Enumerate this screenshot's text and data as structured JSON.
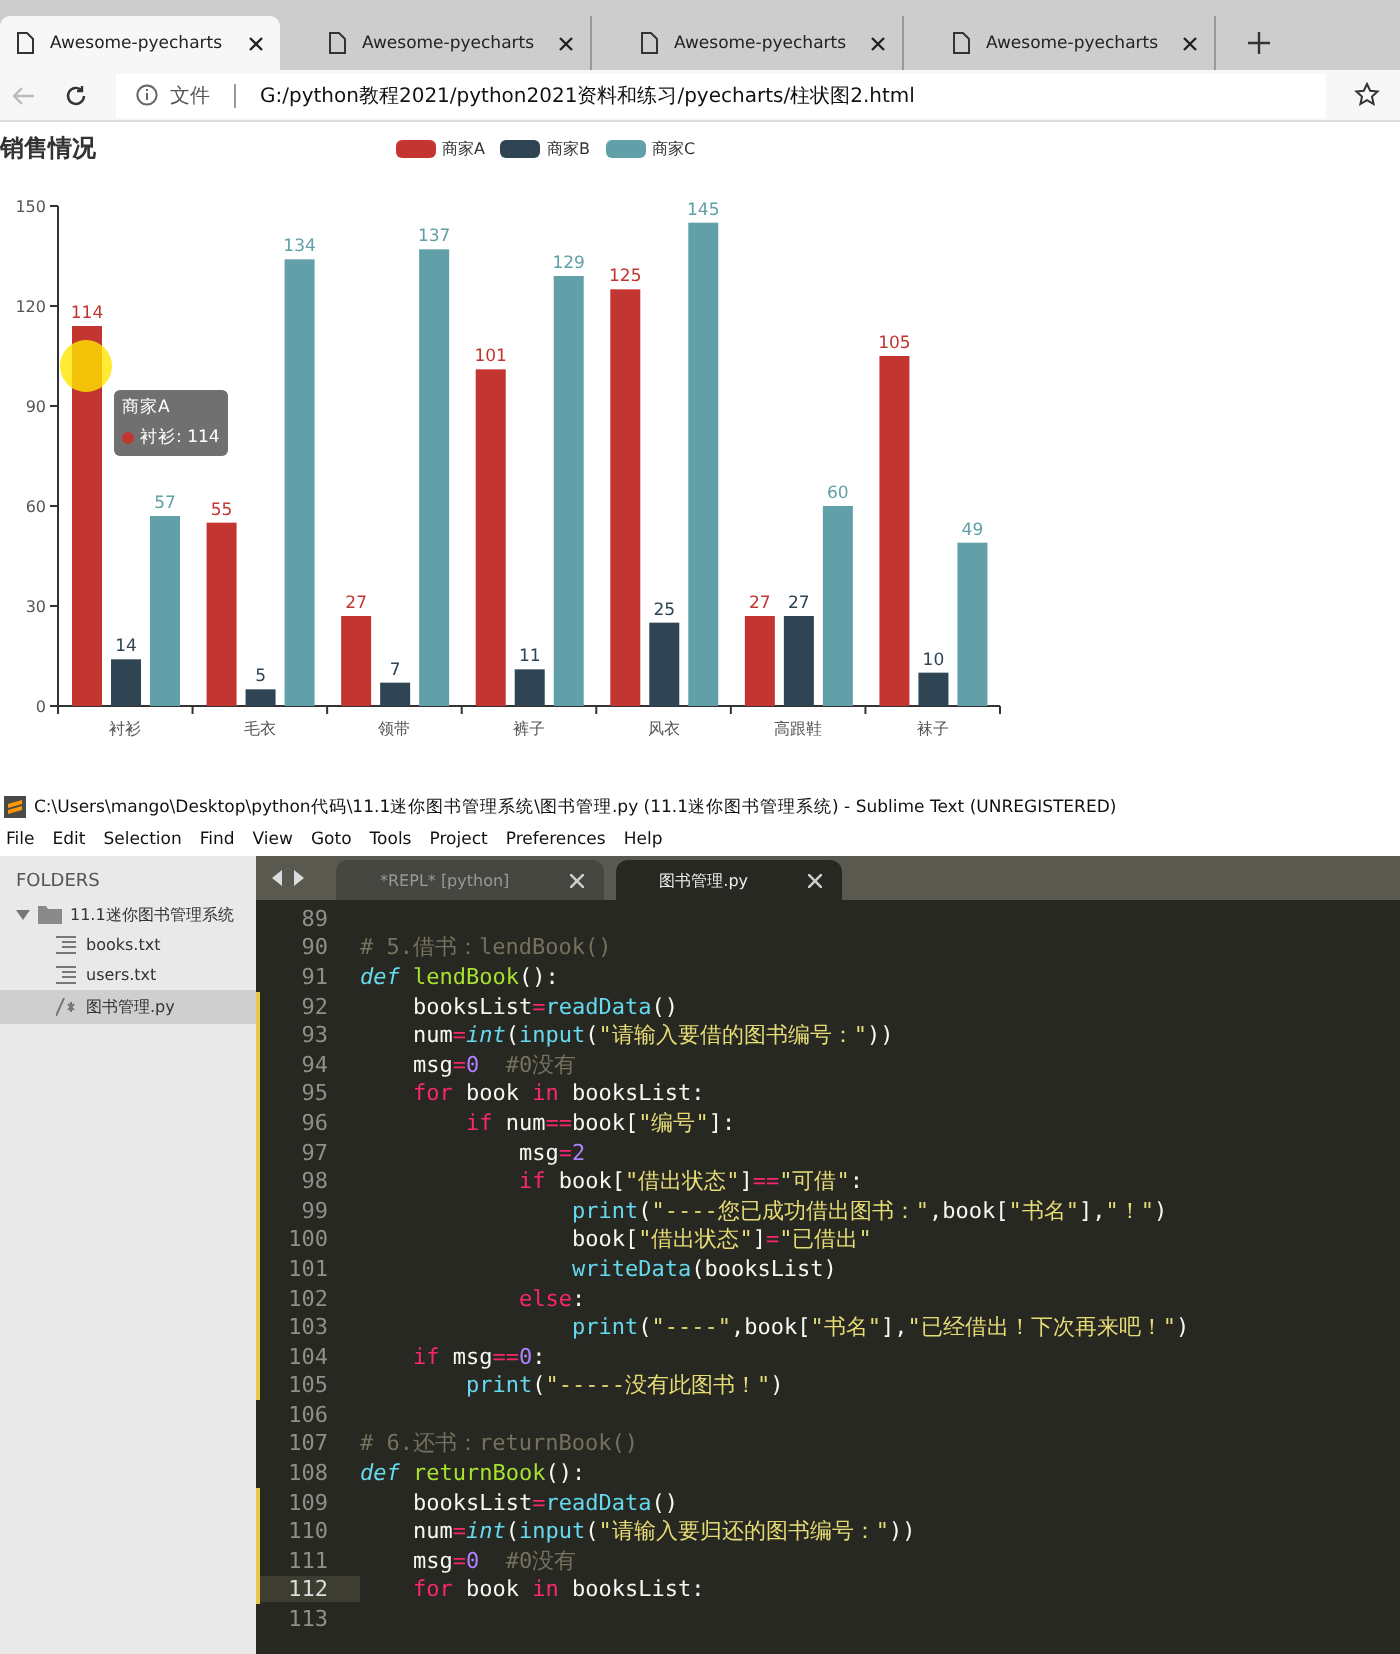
{
  "browser": {
    "tabs": [
      {
        "label": "Awesome-pyecharts",
        "selected": true
      },
      {
        "label": "Awesome-pyecharts",
        "selected": false
      },
      {
        "label": "Awesome-pyecharts",
        "selected": false
      },
      {
        "label": "Awesome-pyecharts",
        "selected": false
      }
    ],
    "address_bar": {
      "scheme_label": "文件",
      "url": "G:/python教程2021/python2021资料和练习/pyecharts/柱状图2.html"
    }
  },
  "chart_panel": {
    "title": "销售情况",
    "chart_data": {
      "type": "bar",
      "categories": [
        "衬衫",
        "毛衣",
        "领带",
        "裤子",
        "风衣",
        "高跟鞋",
        "袜子"
      ],
      "series": [
        {
          "name": "商家A",
          "color": "#c23531",
          "values": [
            114,
            55,
            27,
            101,
            125,
            27,
            105
          ]
        },
        {
          "name": "商家B",
          "color": "#2f4554",
          "values": [
            14,
            5,
            7,
            11,
            25,
            27,
            10
          ]
        },
        {
          "name": "商家C",
          "color": "#61a0a8",
          "values": [
            57,
            134,
            137,
            129,
            145,
            60,
            49
          ]
        }
      ],
      "ylim": [
        0,
        150
      ],
      "yticks": [
        0,
        30,
        60,
        90,
        120,
        150
      ],
      "data_labels": true
    },
    "tooltip": {
      "title": "商家A",
      "text": "衬衫: 114"
    }
  },
  "editor": {
    "title": "C:\\Users\\mango\\Desktop\\python代码\\11.1迷你图书管理系统\\图书管理.py (11.1迷你图书管理系统) - Sublime Text (UNREGISTERED)",
    "menu": [
      "File",
      "Edit",
      "Selection",
      "Find",
      "View",
      "Goto",
      "Tools",
      "Project",
      "Preferences",
      "Help"
    ],
    "sidebar": {
      "header": "FOLDERS",
      "folders": [
        {
          "name": "11.1迷你图书管理系统",
          "expanded": true,
          "children": [
            {
              "name": "books.txt",
              "kind": "text",
              "selected": false
            },
            {
              "name": "users.txt",
              "kind": "text",
              "selected": false
            },
            {
              "name": "图书管理.py",
              "kind": "code",
              "selected": true
            }
          ]
        }
      ]
    },
    "tabs": [
      {
        "label": "*REPL* [python]",
        "selected": false
      },
      {
        "label": "图书管理.py",
        "selected": true
      }
    ],
    "lines": [
      {
        "number": "89",
        "modified": false,
        "current": false
      },
      {
        "number": "90",
        "modified": false,
        "current": false,
        "tokens": [
          {
            "kind": "comment",
            "text": "# 5.借书：lendBook()"
          }
        ]
      },
      {
        "number": "91",
        "modified": false,
        "current": false,
        "tokens": [
          {
            "kind": "storage",
            "text": "def "
          },
          {
            "kind": "entity",
            "text": "lendBook"
          },
          {
            "kind": "plain",
            "text": "():"
          }
        ]
      },
      {
        "number": "92",
        "modified": true,
        "current": false,
        "tokens": [
          {
            "kind": "plain",
            "text": "    booksList"
          },
          {
            "kind": "operator",
            "text": "="
          },
          {
            "kind": "call",
            "text": "readData"
          },
          {
            "kind": "plain",
            "text": "()"
          }
        ]
      },
      {
        "number": "93",
        "modified": true,
        "current": false,
        "tokens": [
          {
            "kind": "plain",
            "text": "    num"
          },
          {
            "kind": "operator",
            "text": "="
          },
          {
            "kind": "storage",
            "text": "int"
          },
          {
            "kind": "plain",
            "text": "("
          },
          {
            "kind": "call",
            "text": "input"
          },
          {
            "kind": "plain",
            "text": "("
          },
          {
            "kind": "string",
            "text": "\"请输入要借的图书编号：\""
          },
          {
            "kind": "plain",
            "text": "))"
          }
        ]
      },
      {
        "number": "94",
        "modified": true,
        "current": false,
        "tokens": [
          {
            "kind": "plain",
            "text": "    msg"
          },
          {
            "kind": "operator",
            "text": "="
          },
          {
            "kind": "number",
            "text": "0"
          },
          {
            "kind": "comment",
            "text": "  #0没有"
          }
        ]
      },
      {
        "number": "95",
        "modified": true,
        "current": false,
        "tokens": [
          {
            "kind": "keyword",
            "text": "    for"
          },
          {
            "kind": "plain",
            "text": " book "
          },
          {
            "kind": "keyword",
            "text": "in"
          },
          {
            "kind": "plain",
            "text": " booksList:"
          }
        ]
      },
      {
        "number": "96",
        "modified": true,
        "current": false,
        "tokens": [
          {
            "kind": "keyword",
            "text": "        if"
          },
          {
            "kind": "plain",
            "text": " num"
          },
          {
            "kind": "operator",
            "text": "=="
          },
          {
            "kind": "plain",
            "text": "book["
          },
          {
            "kind": "string",
            "text": "\"编号\""
          },
          {
            "kind": "plain",
            "text": "]:"
          }
        ]
      },
      {
        "number": "97",
        "modified": true,
        "current": false,
        "tokens": [
          {
            "kind": "plain",
            "text": "            msg"
          },
          {
            "kind": "operator",
            "text": "="
          },
          {
            "kind": "number",
            "text": "2"
          }
        ]
      },
      {
        "number": "98",
        "modified": true,
        "current": false,
        "tokens": [
          {
            "kind": "keyword",
            "text": "            if"
          },
          {
            "kind": "plain",
            "text": " book["
          },
          {
            "kind": "string",
            "text": "\"借出状态\""
          },
          {
            "kind": "plain",
            "text": "]"
          },
          {
            "kind": "operator",
            "text": "=="
          },
          {
            "kind": "string",
            "text": "\"可借\""
          },
          {
            "kind": "plain",
            "text": ":"
          }
        ]
      },
      {
        "number": "99",
        "modified": true,
        "current": false,
        "tokens": [
          {
            "kind": "call",
            "text": "                print"
          },
          {
            "kind": "plain",
            "text": "("
          },
          {
            "kind": "string",
            "text": "\"----您已成功借出图书：\""
          },
          {
            "kind": "plain",
            "text": ",book["
          },
          {
            "kind": "string",
            "text": "\"书名\""
          },
          {
            "kind": "plain",
            "text": "],"
          },
          {
            "kind": "string",
            "text": "\"！\""
          },
          {
            "kind": "plain",
            "text": ")"
          }
        ]
      },
      {
        "number": "100",
        "modified": true,
        "current": false,
        "tokens": [
          {
            "kind": "plain",
            "text": "                book["
          },
          {
            "kind": "string",
            "text": "\"借出状态\""
          },
          {
            "kind": "plain",
            "text": "]"
          },
          {
            "kind": "operator",
            "text": "="
          },
          {
            "kind": "string",
            "text": "\"已借出\""
          }
        ]
      },
      {
        "number": "101",
        "modified": true,
        "current": false,
        "tokens": [
          {
            "kind": "call",
            "text": "                writeData"
          },
          {
            "kind": "plain",
            "text": "(booksList)"
          }
        ]
      },
      {
        "number": "102",
        "modified": true,
        "current": false,
        "tokens": [
          {
            "kind": "keyword",
            "text": "            else"
          },
          {
            "kind": "plain",
            "text": ":"
          }
        ]
      },
      {
        "number": "103",
        "modified": true,
        "current": false,
        "tokens": [
          {
            "kind": "call",
            "text": "                print"
          },
          {
            "kind": "plain",
            "text": "("
          },
          {
            "kind": "string",
            "text": "\"----\""
          },
          {
            "kind": "plain",
            "text": ",book["
          },
          {
            "kind": "string",
            "text": "\"书名\""
          },
          {
            "kind": "plain",
            "text": "],"
          },
          {
            "kind": "string",
            "text": "\"已经借出！下次再来吧！\""
          },
          {
            "kind": "plain",
            "text": ")"
          }
        ]
      },
      {
        "number": "104",
        "modified": true,
        "current": false,
        "tokens": [
          {
            "kind": "keyword",
            "text": "    if"
          },
          {
            "kind": "plain",
            "text": " msg"
          },
          {
            "kind": "operator",
            "text": "=="
          },
          {
            "kind": "number",
            "text": "0"
          },
          {
            "kind": "plain",
            "text": ":"
          }
        ]
      },
      {
        "number": "105",
        "modified": true,
        "current": false,
        "tokens": [
          {
            "kind": "call",
            "text": "        print"
          },
          {
            "kind": "plain",
            "text": "("
          },
          {
            "kind": "string",
            "text": "\"-----没有此图书！\""
          },
          {
            "kind": "plain",
            "text": ")"
          }
        ]
      },
      {
        "number": "106",
        "modified": false,
        "current": false
      },
      {
        "number": "107",
        "modified": false,
        "current": false,
        "tokens": [
          {
            "kind": "comment",
            "text": "# 6.还书：returnBook()"
          }
        ]
      },
      {
        "number": "108",
        "modified": false,
        "current": false,
        "tokens": [
          {
            "kind": "storage",
            "text": "def "
          },
          {
            "kind": "entity",
            "text": "returnBook"
          },
          {
            "kind": "plain",
            "text": "():"
          }
        ]
      },
      {
        "number": "109",
        "modified": true,
        "current": false,
        "tokens": [
          {
            "kind": "plain",
            "text": "    booksList"
          },
          {
            "kind": "operator",
            "text": "="
          },
          {
            "kind": "call",
            "text": "readData"
          },
          {
            "kind": "plain",
            "text": "()"
          }
        ]
      },
      {
        "number": "110",
        "modified": true,
        "current": false,
        "tokens": [
          {
            "kind": "plain",
            "text": "    num"
          },
          {
            "kind": "operator",
            "text": "="
          },
          {
            "kind": "storage",
            "text": "int"
          },
          {
            "kind": "plain",
            "text": "("
          },
          {
            "kind": "call",
            "text": "input"
          },
          {
            "kind": "plain",
            "text": "("
          },
          {
            "kind": "string",
            "text": "\"请输入要归还的图书编号：\""
          },
          {
            "kind": "plain",
            "text": "))"
          }
        ]
      },
      {
        "number": "111",
        "modified": true,
        "current": false,
        "tokens": [
          {
            "kind": "plain",
            "text": "    msg"
          },
          {
            "kind": "operator",
            "text": "="
          },
          {
            "kind": "number",
            "text": "0"
          },
          {
            "kind": "comment",
            "text": "  #0没有"
          }
        ]
      },
      {
        "number": "112",
        "modified": true,
        "current": true,
        "tokens": [
          {
            "kind": "keyword",
            "text": "    for"
          },
          {
            "kind": "plain",
            "text": " book "
          },
          {
            "kind": "keyword",
            "text": "in"
          },
          {
            "kind": "plain",
            "text": " booksList:"
          }
        ]
      },
      {
        "number": "113",
        "modified": false,
        "current": false
      }
    ]
  }
}
